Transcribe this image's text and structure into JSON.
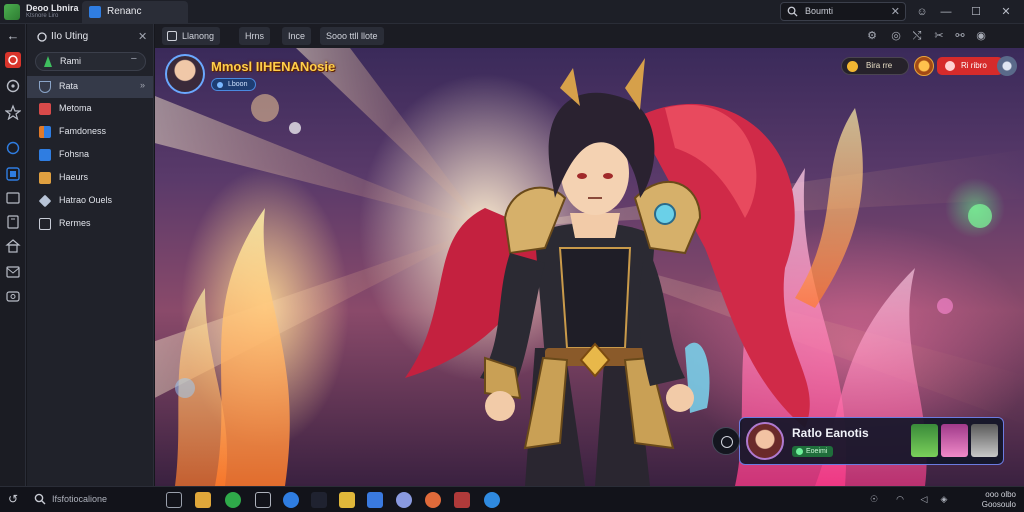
{
  "window": {
    "app_name": "Deoo Lbnira",
    "app_subtitle": "Ktsnore Liro",
    "tab_title": "Renanc",
    "search_value": "Boumti"
  },
  "sidebar": {
    "header": "IIo Uting",
    "select_label": "Rami",
    "items": [
      {
        "label": "Rata",
        "icon": "shield-icon",
        "color": "#8aa4c8"
      },
      {
        "label": "Metoma",
        "icon": "app-icon",
        "color": "#d84a4a"
      },
      {
        "label": "Famdoness",
        "icon": "book-icon",
        "color": "#e07a2a"
      },
      {
        "label": "Fohsna",
        "icon": "card-icon",
        "color": "#2f7de1"
      },
      {
        "label": "Haeurs",
        "icon": "bag-icon",
        "color": "#e0a040"
      },
      {
        "label": "Hatrao Ouels",
        "icon": "diamond-icon",
        "color": "#b8c4d8"
      },
      {
        "label": "Rermes",
        "icon": "book-open-icon",
        "color": "#c8ccd6"
      }
    ]
  },
  "toolbar": {
    "buttons": [
      "Llanong",
      "Hrns",
      "Ince",
      "Sooo ttll llote"
    ]
  },
  "game": {
    "hero_name": "Mmosl IIHENANosie",
    "hero_badge": "Lboon",
    "gold_pill": "Bira rre",
    "red_pill": "Ri ribro",
    "panel_title": "Ratlo Eanotis",
    "panel_badge": "Eoeimi"
  },
  "taskbar": {
    "search_text": "Ifsfotiocalione",
    "clock_time": "ooo olbo",
    "clock_date": "Goosoulo"
  }
}
